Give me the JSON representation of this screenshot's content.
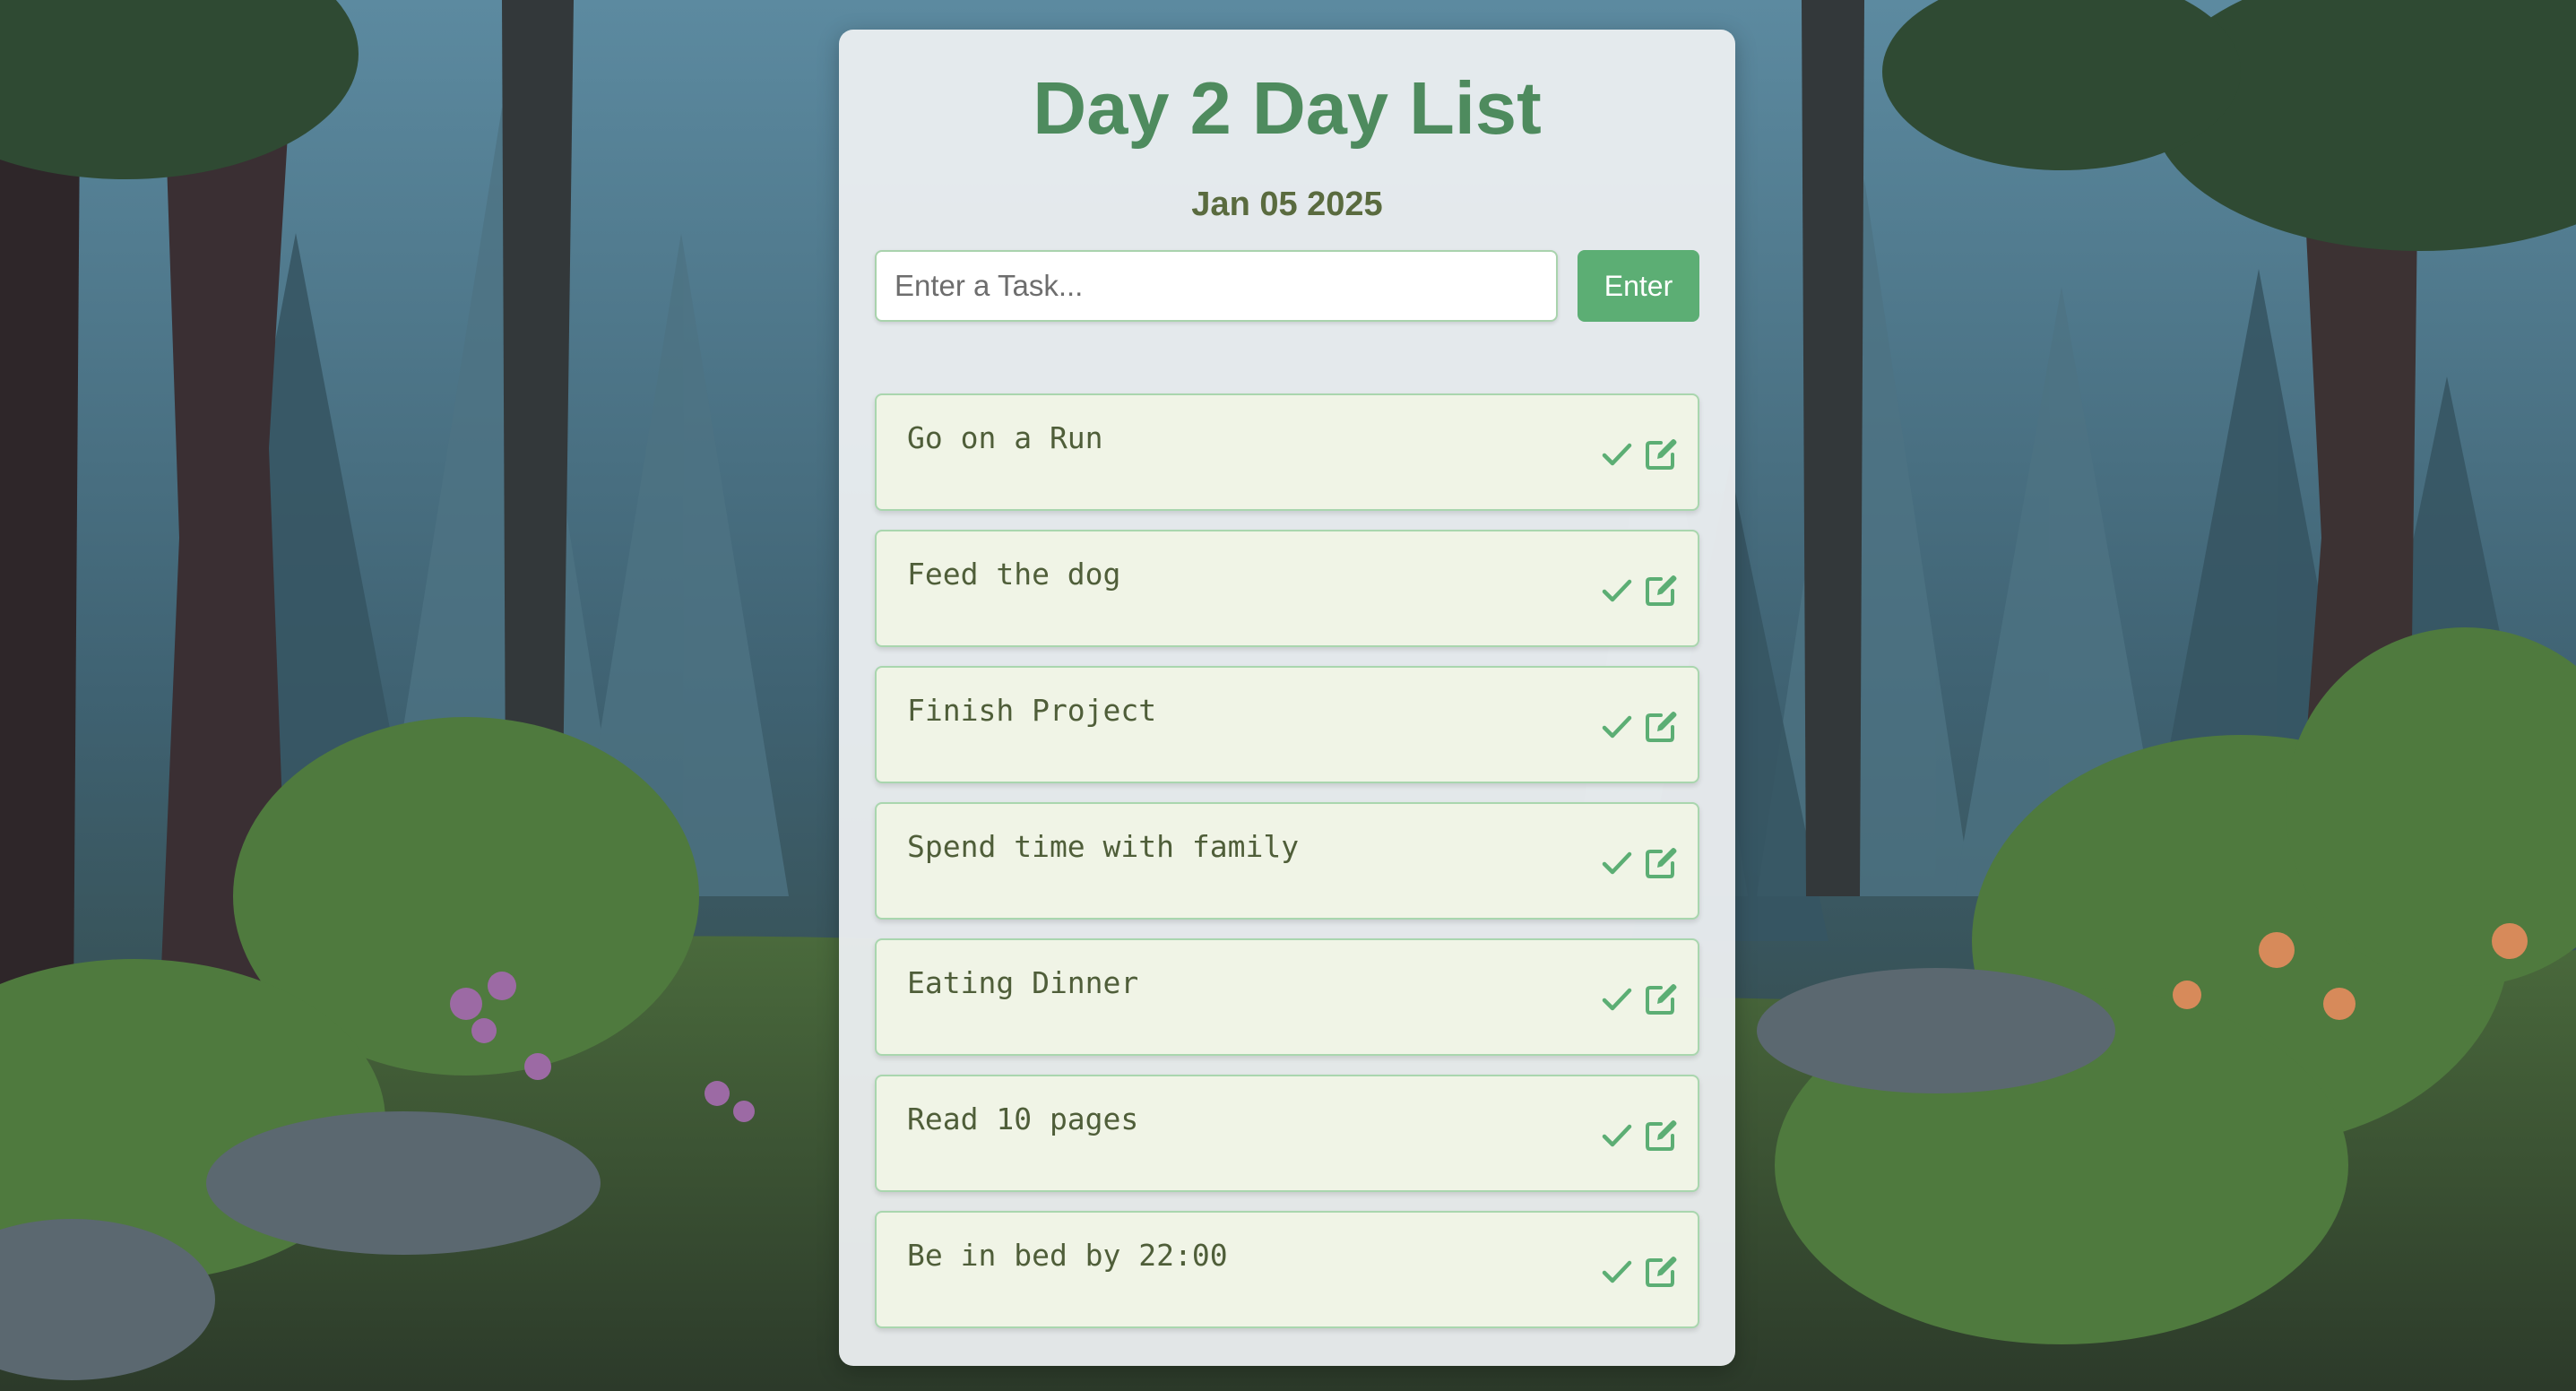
{
  "app": {
    "title": "Day 2 Day List",
    "date": "Jan 05 2025"
  },
  "task_form": {
    "input_placeholder": "Enter a Task...",
    "input_value": "",
    "enter_label": "Enter"
  },
  "tasks": [
    {
      "text": "Go on a Run",
      "actions": [
        "check-icon",
        "edit-icon"
      ]
    },
    {
      "text": "Feed the dog",
      "actions": [
        "check-icon",
        "edit-icon"
      ]
    },
    {
      "text": "Finish Project",
      "actions": [
        "check-icon",
        "edit-icon"
      ]
    },
    {
      "text": "Spend time with family",
      "actions": [
        "check-icon",
        "edit-icon"
      ]
    },
    {
      "text": "Eating Dinner",
      "actions": [
        "check-icon",
        "edit-icon"
      ]
    },
    {
      "text": "Read 10 pages",
      "actions": [
        "check-icon",
        "edit-icon"
      ]
    },
    {
      "text": "Be in bed by 22:00",
      "actions": [
        "check-icon",
        "edit-icon"
      ]
    }
  ],
  "colors": {
    "title": "#4e8b5e",
    "date": "#5a6b3f",
    "button": "#5cae74",
    "icon": "#5cae74",
    "task_bg": "#f0f4e6",
    "task_border": "#a9d6ae",
    "task_text": "#4f5e39"
  }
}
